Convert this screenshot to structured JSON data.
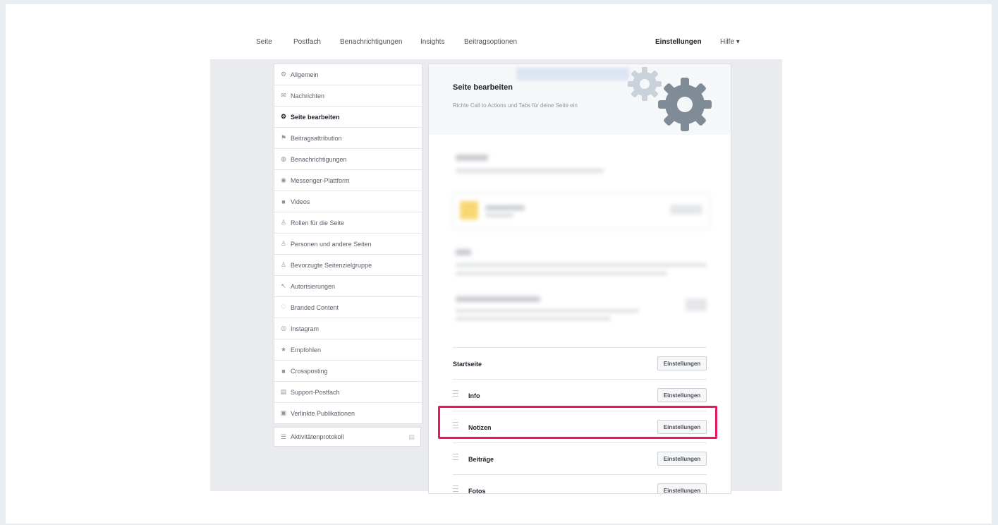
{
  "topnav": {
    "items": [
      {
        "label": "Seite"
      },
      {
        "label": "Postfach"
      },
      {
        "label": "Benachrichtigungen"
      },
      {
        "label": "Insights"
      },
      {
        "label": "Beitragsoptionen"
      }
    ],
    "settings_label": "Einstellungen",
    "help_label": "Hilfe ▾"
  },
  "sidebar": {
    "items": [
      {
        "label": "Allgemein",
        "icon": "gear-icon"
      },
      {
        "label": "Nachrichten",
        "icon": "chat-icon"
      },
      {
        "label": "Seite bearbeiten",
        "icon": "gear-icon"
      },
      {
        "label": "Beitragsattribution",
        "icon": "flag-icon"
      },
      {
        "label": "Benachrichtigungen",
        "icon": "globe-icon"
      },
      {
        "label": "Messenger-Plattform",
        "icon": "messenger-icon"
      },
      {
        "label": "Videos",
        "icon": "video-icon"
      },
      {
        "label": "Rollen für die Seite",
        "icon": "person-icon"
      },
      {
        "label": "Personen und andere Seiten",
        "icon": "people-icon"
      },
      {
        "label": "Bevorzugte Seitenzielgruppe",
        "icon": "people-icon"
      },
      {
        "label": "Autorisierungen",
        "icon": "key-icon"
      },
      {
        "label": "Branded Content",
        "icon": "handshake-icon"
      },
      {
        "label": "Instagram",
        "icon": "instagram-icon"
      },
      {
        "label": "Empfohlen",
        "icon": "star-icon"
      },
      {
        "label": "Crossposting",
        "icon": "video-icon"
      },
      {
        "label": "Support-Postfach",
        "icon": "inbox-icon"
      },
      {
        "label": "Verlinkte Publikationen",
        "icon": "document-icon"
      }
    ],
    "active_index": 2,
    "activity_label": "Aktivitätenprotokoll"
  },
  "main": {
    "title": "Seite bearbeiten",
    "subtitle": "Richte Call to Actions und Tabs für deine Seite ein",
    "first_row_label": "Startseite",
    "tabs": [
      {
        "label": "Info",
        "button": "Einstellungen"
      },
      {
        "label": "Notizen",
        "button": "Einstellungen"
      },
      {
        "label": "Beiträge",
        "button": "Einstellungen"
      },
      {
        "label": "Fotos",
        "button": "Einstellungen"
      }
    ],
    "first_row_button": "Einstellungen"
  },
  "colors": {
    "accent": "#4267b2",
    "highlight": "#e8195f",
    "background": "#e9ebee"
  }
}
